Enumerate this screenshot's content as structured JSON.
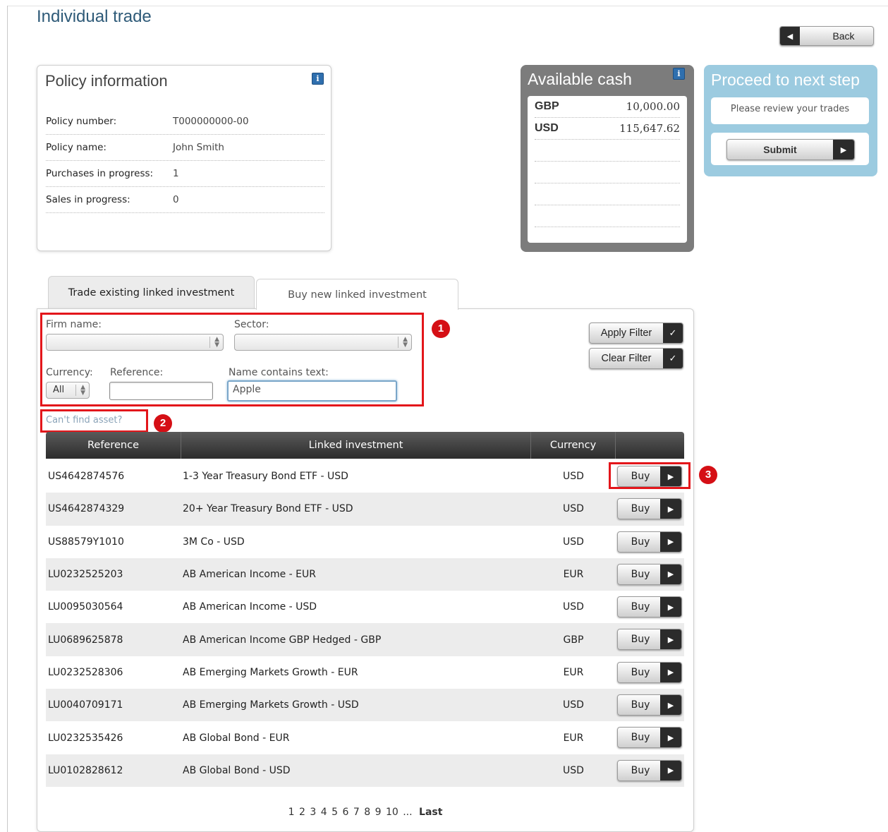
{
  "page": {
    "title": "Individual trade",
    "back_label": "Back"
  },
  "policy": {
    "title": "Policy information",
    "info_icon": "i",
    "rows": [
      {
        "label": "Policy number:",
        "value": "T000000000-00"
      },
      {
        "label": "Policy name:",
        "value": "John Smith"
      },
      {
        "label": "Purchases in progress:",
        "value": "1"
      },
      {
        "label": "Sales in progress:",
        "value": "0"
      }
    ]
  },
  "cash": {
    "title": "Available cash",
    "info_icon": "i",
    "rows": [
      {
        "currency": "GBP",
        "amount": "10,000.00"
      },
      {
        "currency": "USD",
        "amount": "115,647.62"
      }
    ]
  },
  "proceed": {
    "title": "Proceed to next step",
    "message": "Please review your trades",
    "submit_label": "Submit"
  },
  "tabs": [
    {
      "label": "Trade existing linked investment"
    },
    {
      "label": "Buy new linked investment"
    }
  ],
  "filters": {
    "firm_label": "Firm name:",
    "firm_value": "",
    "sector_label": "Sector:",
    "sector_value": "",
    "currency_label": "Currency:",
    "currency_value": "All",
    "reference_label": "Reference:",
    "reference_value": "",
    "name_label": "Name contains text:",
    "name_value": "Apple",
    "apply_label": "Apply Filter",
    "clear_label": "Clear Filter",
    "cant_find": "Can't find asset?"
  },
  "callouts": [
    "1",
    "2",
    "3"
  ],
  "table": {
    "headers": [
      "Reference",
      "Linked investment",
      "Currency"
    ],
    "buy_label": "Buy",
    "rows": [
      {
        "ref": "US4642874576",
        "name": "1-3 Year Treasury Bond ETF - USD",
        "cur": "USD"
      },
      {
        "ref": "US4642874329",
        "name": "20+ Year Treasury Bond ETF - USD",
        "cur": "USD"
      },
      {
        "ref": "US88579Y1010",
        "name": "3M Co - USD",
        "cur": "USD"
      },
      {
        "ref": "LU0232525203",
        "name": "AB American Income - EUR",
        "cur": "EUR"
      },
      {
        "ref": "LU0095030564",
        "name": "AB American Income - USD",
        "cur": "USD"
      },
      {
        "ref": "LU0689625878",
        "name": "AB American Income GBP Hedged - GBP",
        "cur": "GBP"
      },
      {
        "ref": "LU0232528306",
        "name": "AB Emerging Markets Growth - EUR",
        "cur": "EUR"
      },
      {
        "ref": "LU0040709171",
        "name": "AB Emerging Markets Growth - USD",
        "cur": "USD"
      },
      {
        "ref": "LU0232535426",
        "name": "AB Global Bond - EUR",
        "cur": "EUR"
      },
      {
        "ref": "LU0102828612",
        "name": "AB Global Bond - USD",
        "cur": "USD"
      }
    ]
  },
  "pager": {
    "pages": [
      "1",
      "2",
      "3",
      "4",
      "5",
      "6",
      "7",
      "8",
      "9",
      "10"
    ],
    "ellipsis": "...",
    "last": "Last"
  }
}
